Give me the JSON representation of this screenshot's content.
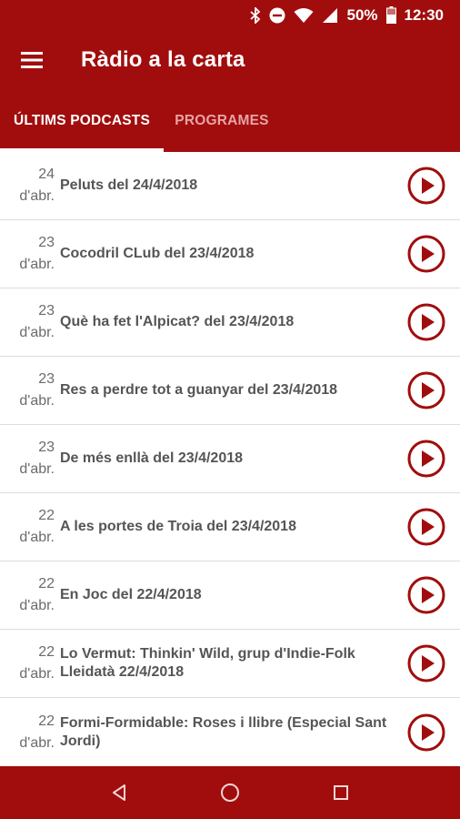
{
  "status_bar": {
    "battery_percent": "50%",
    "time": "12:30",
    "icons": [
      "bluetooth-icon",
      "do-not-disturb-icon",
      "wifi-icon",
      "signal-icon",
      "battery-icon"
    ]
  },
  "app_bar": {
    "title": "Ràdio a la carta",
    "menu_icon": "hamburger-menu-icon"
  },
  "tabs": [
    {
      "label": "ÚLTIMS PODCASTS",
      "active": true
    },
    {
      "label": "PROGRAMES",
      "active": false
    }
  ],
  "podcasts": [
    {
      "day": "24",
      "month": "d'abr.",
      "title": "Peluts del 24/4/2018"
    },
    {
      "day": "23",
      "month": "d'abr.",
      "title": "Cocodril CLub del 23/4/2018"
    },
    {
      "day": "23",
      "month": "d'abr.",
      "title": "Què ha fet l'Alpicat? del 23/4/2018"
    },
    {
      "day": "23",
      "month": "d'abr.",
      "title": "Res a perdre tot a guanyar del 23/4/2018"
    },
    {
      "day": "23",
      "month": "d'abr.",
      "title": "De més enllà del 23/4/2018"
    },
    {
      "day": "22",
      "month": "d'abr.",
      "title": "A les portes de Troia del 23/4/2018"
    },
    {
      "day": "22",
      "month": "d'abr.",
      "title": "En Joc del 22/4/2018"
    },
    {
      "day": "22",
      "month": "d'abr.",
      "title": "Lo Vermut: Thinkin' Wild, grup d'Indie-Folk Lleidatà 22/4/2018"
    },
    {
      "day": "22",
      "month": "d'abr.",
      "title": "Formi-Formidable: Roses i llibre (Especial Sant Jordi)"
    }
  ],
  "colors": {
    "primary": "#a10d0d",
    "play_icon": "#a10d0d",
    "inactive_tab": "#e8a4a4"
  },
  "nav_bar": {
    "buttons": [
      "back-icon",
      "home-icon",
      "recents-icon"
    ]
  }
}
